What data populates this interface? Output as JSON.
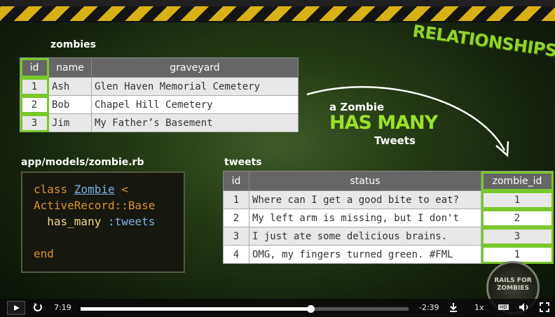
{
  "slide": {
    "relationships_title": "RELATIONSHIPS",
    "zombies_title": "zombies",
    "zombies_columns": [
      "id",
      "name",
      "graveyard"
    ],
    "zombies_rows": [
      [
        "1",
        "Ash",
        "Glen Haven Memorial Cemetery"
      ],
      [
        "2",
        "Bob",
        "Chapel Hill Cemetery"
      ],
      [
        "3",
        "Jim",
        "My Father’s Basement"
      ]
    ],
    "caption_line1": "a Zombie",
    "caption_line2": "HAS MANY",
    "caption_line3": "Tweets",
    "model_file": "app/models/zombie.rb",
    "code": {
      "class_kw": "class",
      "class_name": "Zombie",
      "lt": "<",
      "base": "ActiveRecord::Base",
      "method": "has_many",
      "symbol": ":tweets",
      "end_kw": "end"
    },
    "tweets_title": "tweets",
    "tweets_columns": [
      "id",
      "status",
      "zombie_id"
    ],
    "tweets_rows": [
      [
        "1",
        "Where can I get a good bite to eat?",
        "1"
      ],
      [
        "2",
        "My left arm is missing, but I don't",
        "2"
      ],
      [
        "3",
        "I just ate some delicious brains.",
        "3"
      ],
      [
        "4",
        "OMG, my fingers turned green. #FML",
        "1"
      ]
    ],
    "badge_text": "RAILS FOR ZOMBIES"
  },
  "player": {
    "elapsed": "7:19",
    "remaining": "-2:39",
    "progress": 0.7,
    "speed": "1x",
    "cc_label": "HD"
  },
  "colors": {
    "accent_green": "#7ac72a",
    "hazard_yellow": "#d8b116"
  }
}
